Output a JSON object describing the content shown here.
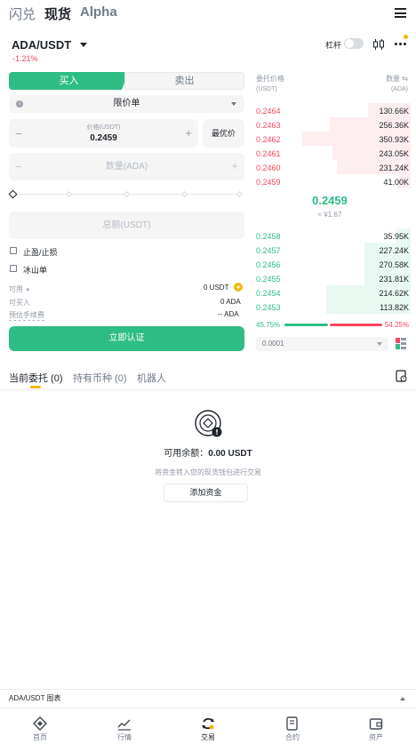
{
  "top_tabs": {
    "flash": "闪兑",
    "spot": "现货",
    "alpha": "Alpha"
  },
  "pair": {
    "name": "ADA/USDT",
    "change": "-1.21%"
  },
  "toolbar": {
    "leverage": "杠杆"
  },
  "order_form": {
    "buy": "买入",
    "sell": "卖出",
    "order_type": "限价单",
    "price_label": "价格(USDT)",
    "price_value": "0.2459",
    "best_price": "最优价",
    "quantity_placeholder": "数量(ADA)",
    "total_placeholder": "总额(USDT)",
    "tp_sl": "止盈/止损",
    "iceberg": "冰山单",
    "available_label": "可用",
    "available_value": "0 USDT",
    "can_buy_label": "可买入",
    "can_buy_value": "0 ADA",
    "fee_label": "预估手续费",
    "fee_value": "-- ADA",
    "submit": "立即认证"
  },
  "orderbook": {
    "header_price": "委托价格",
    "header_price_unit": "(USDT)",
    "header_qty": "数量",
    "header_qty_unit": "(ADA)",
    "asks": [
      {
        "price": "0.2464",
        "qty": "130.66K",
        "depth": 0.39
      },
      {
        "price": "0.2463",
        "qty": "256.36K",
        "depth": 0.75
      },
      {
        "price": "0.2462",
        "qty": "350.93K",
        "depth": 1.0
      },
      {
        "price": "0.2461",
        "qty": "243.05K",
        "depth": 0.72
      },
      {
        "price": "0.2460",
        "qty": "231.24K",
        "depth": 0.68
      },
      {
        "price": "0.2459",
        "qty": "41.00K",
        "depth": 0.12
      }
    ],
    "last_price": "0.2459",
    "last_price_fiat": "≈ ¥1.67",
    "bids": [
      {
        "price": "0.2458",
        "qty": "35.95K",
        "depth": 0.13
      },
      {
        "price": "0.2457",
        "qty": "227.24K",
        "depth": 0.43
      },
      {
        "price": "0.2456",
        "qty": "270.58K",
        "depth": 0.43
      },
      {
        "price": "0.2455",
        "qty": "231.81K",
        "depth": 0.43
      },
      {
        "price": "0.2454",
        "qty": "214.62K",
        "depth": 0.78
      },
      {
        "price": "0.2453",
        "qty": "113.82K",
        "depth": 0.78
      }
    ],
    "buy_ratio": "45.75%",
    "sell_ratio": "54.25%",
    "buy_fraction": 0.4575,
    "precision": "0.0001"
  },
  "orders_tabs": {
    "current": "当前委托 (0)",
    "holdings": "持有币种 (0)",
    "bots": "机器人"
  },
  "empty": {
    "balance_label": "可用余额：",
    "balance_value": "0.00 USDT",
    "hint": "将资金转入您的现货钱包进行交易",
    "add_funds": "添加资金"
  },
  "chart_bar": {
    "label": "ADA/USDT 图表"
  },
  "bottom_nav": {
    "home": "首页",
    "markets": "行情",
    "trade": "交易",
    "futures": "合约",
    "assets": "资产"
  }
}
